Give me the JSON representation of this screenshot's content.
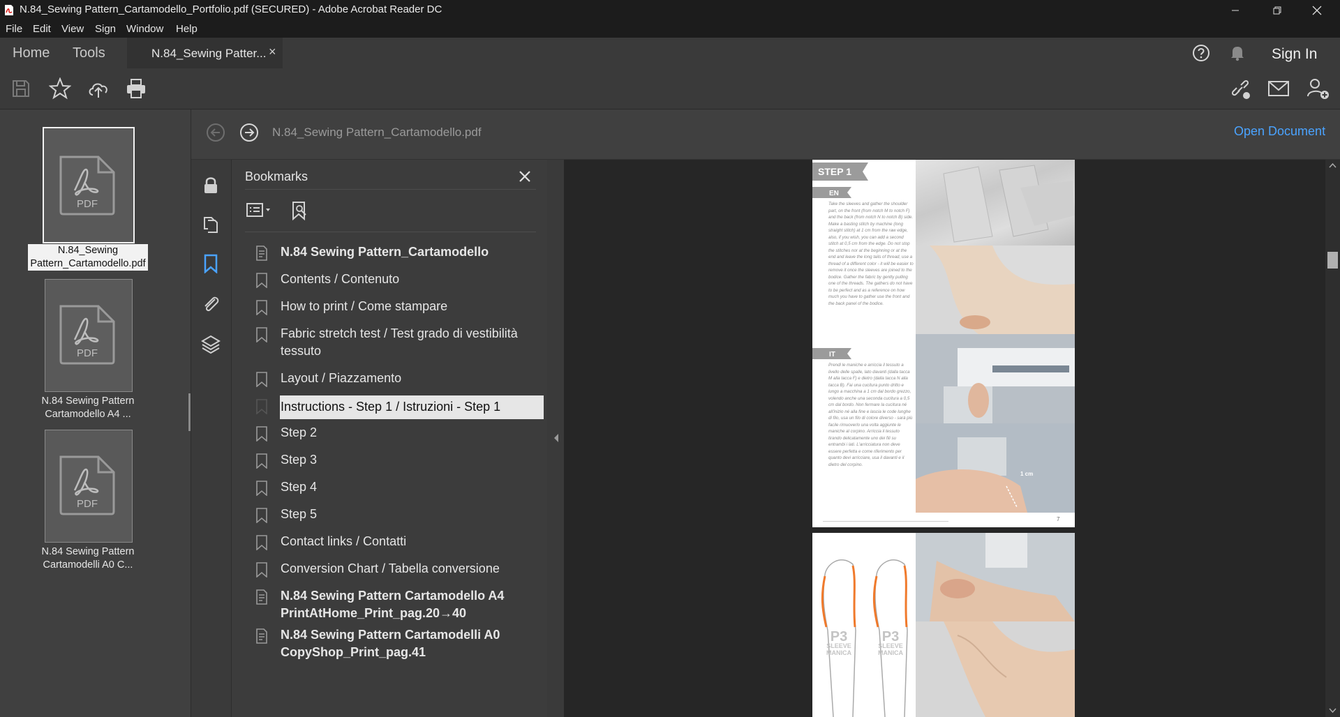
{
  "window": {
    "title": "N.84_Sewing Pattern_Cartamodello_Portfolio.pdf (SECURED) - Adobe Acrobat Reader DC",
    "controls": [
      "minimize",
      "restore",
      "close"
    ]
  },
  "menu": [
    "File",
    "Edit",
    "View",
    "Sign",
    "Window",
    "Help"
  ],
  "tabs": {
    "home": "Home",
    "tools": "Tools",
    "document": "N.84_Sewing Patter...",
    "close_glyph": "×",
    "sign_in": "Sign In"
  },
  "nav": {
    "filename": "N.84_Sewing Pattern_Cartamodello.pdf",
    "open_document": "Open Document"
  },
  "portfolio": [
    {
      "caption_line1": "N.84_Sewing",
      "caption_line2": "Pattern_Cartamodello.pdf",
      "icon_label": "PDF",
      "selected": true
    },
    {
      "caption_line1": "N.84 Sewing Pattern",
      "caption_line2": "Cartamodello A4 ...",
      "icon_label": "PDF",
      "selected": false
    },
    {
      "caption_line1": "N.84 Sewing Pattern",
      "caption_line2": "Cartamodelli A0 C...",
      "icon_label": "PDF",
      "selected": false
    }
  ],
  "bookmarks": {
    "title": "Bookmarks",
    "items": [
      {
        "line1": "N.84 Sewing Pattern_Cartamodello",
        "line2": "",
        "bold": true,
        "icon": "bookmark-file-icon"
      },
      {
        "line1": "Contents / Contenuto",
        "line2": "",
        "bold": false,
        "icon": "bookmark-icon"
      },
      {
        "line1": "How to print / Come stampare",
        "line2": "",
        "bold": false,
        "icon": "bookmark-icon"
      },
      {
        "line1": "Fabric stretch test / Test grado di vestibilità",
        "line2": "tessuto",
        "bold": false,
        "icon": "bookmark-icon"
      },
      {
        "line1": "Layout / Piazzamento",
        "line2": "",
        "bold": false,
        "icon": "bookmark-icon"
      },
      {
        "line1": "Instructions - Step 1 / Istruzioni - Step 1",
        "line2": "",
        "bold": false,
        "icon": "bookmark-icon",
        "selected": true
      },
      {
        "line1": "Step 2",
        "line2": "",
        "bold": false,
        "icon": "bookmark-icon"
      },
      {
        "line1": "Step 3",
        "line2": "",
        "bold": false,
        "icon": "bookmark-icon"
      },
      {
        "line1": "Step 4",
        "line2": "",
        "bold": false,
        "icon": "bookmark-icon"
      },
      {
        "line1": "Step 5",
        "line2": "",
        "bold": false,
        "icon": "bookmark-icon"
      },
      {
        "line1": "Contact links / Contatti",
        "line2": "",
        "bold": false,
        "icon": "bookmark-icon"
      },
      {
        "line1": "Conversion Chart / Tabella conversione",
        "line2": "",
        "bold": false,
        "icon": "bookmark-icon"
      },
      {
        "line1": "N.84 Sewing Pattern Cartamodello A4",
        "line2": "PrintAtHome_Print_pag.20→40",
        "bold": true,
        "icon": "bookmark-file-icon"
      },
      {
        "line1": "N.84 Sewing Pattern Cartamodelli A0",
        "line2": "CopyShop_Print_pag.41",
        "bold": true,
        "icon": "bookmark-file-icon"
      }
    ]
  },
  "page1": {
    "step_label": "STEP 1",
    "en_label": "EN",
    "it_label": "IT",
    "en_text": "Take the sleeves and gather the shoulder part, on the front (from notch M to notch F) and the back (from notch N to notch B) side. Make a basting stitch by machine (long straight stitch) at 1 cm from the raw edge, also, if you wish, you can add a second stitch at 0,5 cm from the edge. Do not stop the stitches nor at the beginning or at the end and leave the long tails of thread, use a thread of a different color - it will be easier to remove it once the sleeves are joined to the bodice. Gather the fabric by gently pulling one of the threads. The gathers do not have to be perfect and as a reference on how much you have to gather use the front and the back panel of the bodice.",
    "it_text": "Prendi le maniche e arriccia il tessuto a livello delle spalle, lato davanti (dalla tacca M alla tacca F) e dietro (dalla tacca N alla tacca B). Fai una cucitura punto dritto e lungo a macchina a 1 cm dal bordo grezzo, volendo anche una seconda cucitura a 0,5 cm dal bordo. Non fermare la cucitura né all'inizio né alla fine e lascia le code lunghe di filo, usa un filo di colore diverso - sarà più facile rimuoverlo una volta aggiunte le maniche al corpino. Arriccia il tessuto tirando delicatamente uno dei fili su entrambi i lati. L'arricciatura non deve essere perfetta e come riferimento per quanto devi arricciare, usa il davanti e il dietro del corpino.",
    "photo_label": "1 cm",
    "page_number": "7"
  },
  "page2": {
    "piece_label_1": "P3",
    "piece_sub_1a": "SLEEVE",
    "piece_sub_1b": "MANICA",
    "piece_label_2": "P3",
    "piece_sub_2a": "SLEEVE",
    "piece_sub_2b": "MANICA"
  },
  "colors": {
    "accent_blue": "#4aa3ff",
    "selected_bookmark_bg": "#e6e6e6",
    "pattern_orange": "#f07a2c"
  }
}
